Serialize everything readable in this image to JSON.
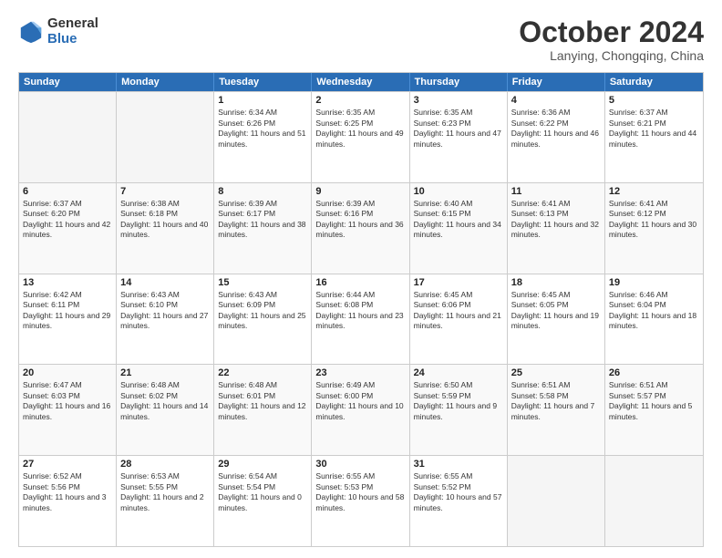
{
  "logo": {
    "general": "General",
    "blue": "Blue"
  },
  "title": "October 2024",
  "subtitle": "Lanying, Chongqing, China",
  "header_days": [
    "Sunday",
    "Monday",
    "Tuesday",
    "Wednesday",
    "Thursday",
    "Friday",
    "Saturday"
  ],
  "weeks": [
    [
      {
        "day": "",
        "sunrise": "",
        "sunset": "",
        "daylight": "",
        "empty": true
      },
      {
        "day": "",
        "sunrise": "",
        "sunset": "",
        "daylight": "",
        "empty": true
      },
      {
        "day": "1",
        "sunrise": "Sunrise: 6:34 AM",
        "sunset": "Sunset: 6:26 PM",
        "daylight": "Daylight: 11 hours and 51 minutes.",
        "empty": false
      },
      {
        "day": "2",
        "sunrise": "Sunrise: 6:35 AM",
        "sunset": "Sunset: 6:25 PM",
        "daylight": "Daylight: 11 hours and 49 minutes.",
        "empty": false
      },
      {
        "day": "3",
        "sunrise": "Sunrise: 6:35 AM",
        "sunset": "Sunset: 6:23 PM",
        "daylight": "Daylight: 11 hours and 47 minutes.",
        "empty": false
      },
      {
        "day": "4",
        "sunrise": "Sunrise: 6:36 AM",
        "sunset": "Sunset: 6:22 PM",
        "daylight": "Daylight: 11 hours and 46 minutes.",
        "empty": false
      },
      {
        "day": "5",
        "sunrise": "Sunrise: 6:37 AM",
        "sunset": "Sunset: 6:21 PM",
        "daylight": "Daylight: 11 hours and 44 minutes.",
        "empty": false
      }
    ],
    [
      {
        "day": "6",
        "sunrise": "Sunrise: 6:37 AM",
        "sunset": "Sunset: 6:20 PM",
        "daylight": "Daylight: 11 hours and 42 minutes.",
        "empty": false
      },
      {
        "day": "7",
        "sunrise": "Sunrise: 6:38 AM",
        "sunset": "Sunset: 6:18 PM",
        "daylight": "Daylight: 11 hours and 40 minutes.",
        "empty": false
      },
      {
        "day": "8",
        "sunrise": "Sunrise: 6:39 AM",
        "sunset": "Sunset: 6:17 PM",
        "daylight": "Daylight: 11 hours and 38 minutes.",
        "empty": false
      },
      {
        "day": "9",
        "sunrise": "Sunrise: 6:39 AM",
        "sunset": "Sunset: 6:16 PM",
        "daylight": "Daylight: 11 hours and 36 minutes.",
        "empty": false
      },
      {
        "day": "10",
        "sunrise": "Sunrise: 6:40 AM",
        "sunset": "Sunset: 6:15 PM",
        "daylight": "Daylight: 11 hours and 34 minutes.",
        "empty": false
      },
      {
        "day": "11",
        "sunrise": "Sunrise: 6:41 AM",
        "sunset": "Sunset: 6:13 PM",
        "daylight": "Daylight: 11 hours and 32 minutes.",
        "empty": false
      },
      {
        "day": "12",
        "sunrise": "Sunrise: 6:41 AM",
        "sunset": "Sunset: 6:12 PM",
        "daylight": "Daylight: 11 hours and 30 minutes.",
        "empty": false
      }
    ],
    [
      {
        "day": "13",
        "sunrise": "Sunrise: 6:42 AM",
        "sunset": "Sunset: 6:11 PM",
        "daylight": "Daylight: 11 hours and 29 minutes.",
        "empty": false
      },
      {
        "day": "14",
        "sunrise": "Sunrise: 6:43 AM",
        "sunset": "Sunset: 6:10 PM",
        "daylight": "Daylight: 11 hours and 27 minutes.",
        "empty": false
      },
      {
        "day": "15",
        "sunrise": "Sunrise: 6:43 AM",
        "sunset": "Sunset: 6:09 PM",
        "daylight": "Daylight: 11 hours and 25 minutes.",
        "empty": false
      },
      {
        "day": "16",
        "sunrise": "Sunrise: 6:44 AM",
        "sunset": "Sunset: 6:08 PM",
        "daylight": "Daylight: 11 hours and 23 minutes.",
        "empty": false
      },
      {
        "day": "17",
        "sunrise": "Sunrise: 6:45 AM",
        "sunset": "Sunset: 6:06 PM",
        "daylight": "Daylight: 11 hours and 21 minutes.",
        "empty": false
      },
      {
        "day": "18",
        "sunrise": "Sunrise: 6:45 AM",
        "sunset": "Sunset: 6:05 PM",
        "daylight": "Daylight: 11 hours and 19 minutes.",
        "empty": false
      },
      {
        "day": "19",
        "sunrise": "Sunrise: 6:46 AM",
        "sunset": "Sunset: 6:04 PM",
        "daylight": "Daylight: 11 hours and 18 minutes.",
        "empty": false
      }
    ],
    [
      {
        "day": "20",
        "sunrise": "Sunrise: 6:47 AM",
        "sunset": "Sunset: 6:03 PM",
        "daylight": "Daylight: 11 hours and 16 minutes.",
        "empty": false
      },
      {
        "day": "21",
        "sunrise": "Sunrise: 6:48 AM",
        "sunset": "Sunset: 6:02 PM",
        "daylight": "Daylight: 11 hours and 14 minutes.",
        "empty": false
      },
      {
        "day": "22",
        "sunrise": "Sunrise: 6:48 AM",
        "sunset": "Sunset: 6:01 PM",
        "daylight": "Daylight: 11 hours and 12 minutes.",
        "empty": false
      },
      {
        "day": "23",
        "sunrise": "Sunrise: 6:49 AM",
        "sunset": "Sunset: 6:00 PM",
        "daylight": "Daylight: 11 hours and 10 minutes.",
        "empty": false
      },
      {
        "day": "24",
        "sunrise": "Sunrise: 6:50 AM",
        "sunset": "Sunset: 5:59 PM",
        "daylight": "Daylight: 11 hours and 9 minutes.",
        "empty": false
      },
      {
        "day": "25",
        "sunrise": "Sunrise: 6:51 AM",
        "sunset": "Sunset: 5:58 PM",
        "daylight": "Daylight: 11 hours and 7 minutes.",
        "empty": false
      },
      {
        "day": "26",
        "sunrise": "Sunrise: 6:51 AM",
        "sunset": "Sunset: 5:57 PM",
        "daylight": "Daylight: 11 hours and 5 minutes.",
        "empty": false
      }
    ],
    [
      {
        "day": "27",
        "sunrise": "Sunrise: 6:52 AM",
        "sunset": "Sunset: 5:56 PM",
        "daylight": "Daylight: 11 hours and 3 minutes.",
        "empty": false
      },
      {
        "day": "28",
        "sunrise": "Sunrise: 6:53 AM",
        "sunset": "Sunset: 5:55 PM",
        "daylight": "Daylight: 11 hours and 2 minutes.",
        "empty": false
      },
      {
        "day": "29",
        "sunrise": "Sunrise: 6:54 AM",
        "sunset": "Sunset: 5:54 PM",
        "daylight": "Daylight: 11 hours and 0 minutes.",
        "empty": false
      },
      {
        "day": "30",
        "sunrise": "Sunrise: 6:55 AM",
        "sunset": "Sunset: 5:53 PM",
        "daylight": "Daylight: 10 hours and 58 minutes.",
        "empty": false
      },
      {
        "day": "31",
        "sunrise": "Sunrise: 6:55 AM",
        "sunset": "Sunset: 5:52 PM",
        "daylight": "Daylight: 10 hours and 57 minutes.",
        "empty": false
      },
      {
        "day": "",
        "sunrise": "",
        "sunset": "",
        "daylight": "",
        "empty": true
      },
      {
        "day": "",
        "sunrise": "",
        "sunset": "",
        "daylight": "",
        "empty": true
      }
    ]
  ]
}
